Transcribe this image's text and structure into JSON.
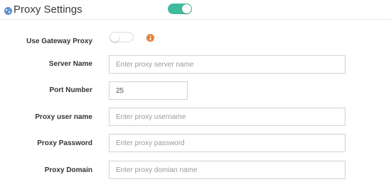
{
  "header": {
    "title": "Proxy Settings",
    "icon": "globe-icon",
    "proxy_enabled": true
  },
  "colors": {
    "accent": "#3fba9c",
    "info": "#e2813b",
    "globe": "#5c8ec9"
  },
  "gateway": {
    "label": "Use Gateway Proxy",
    "enabled": false,
    "info_icon": "info-icon"
  },
  "fields": {
    "server_name": {
      "label": "Server Name",
      "value": "",
      "placeholder": "Enter proxy server name"
    },
    "port_number": {
      "label": "Port Number",
      "value": "25",
      "placeholder": ""
    },
    "proxy_user": {
      "label": "Proxy user name",
      "value": "",
      "placeholder": "Enter proxy username"
    },
    "proxy_password": {
      "label": "Proxy Password",
      "value": "",
      "placeholder": "Enter proxy password"
    },
    "proxy_domain": {
      "label": "Proxy Domain",
      "value": "",
      "placeholder": "Enter proxy domian name"
    }
  }
}
